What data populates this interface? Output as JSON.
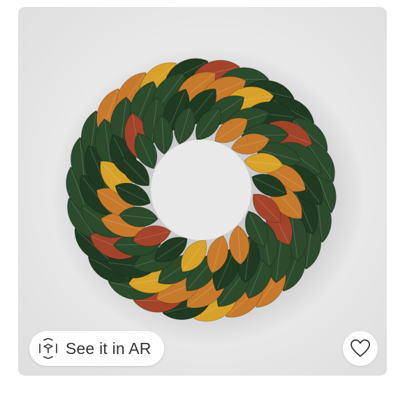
{
  "product": {
    "image_subject": "magnolia-leaf-wreath",
    "leaf_colors": {
      "green": "#2c4a2c",
      "green_dark": "#203a22",
      "yellow": "#d8a22a",
      "orange": "#c77a2c",
      "red": "#a2432a"
    },
    "background_color": "#ebebeb"
  },
  "ar_button": {
    "label": "See it in AR",
    "icon": "ar-cube-icon"
  },
  "favorite_button": {
    "icon": "heart-outline-icon"
  }
}
